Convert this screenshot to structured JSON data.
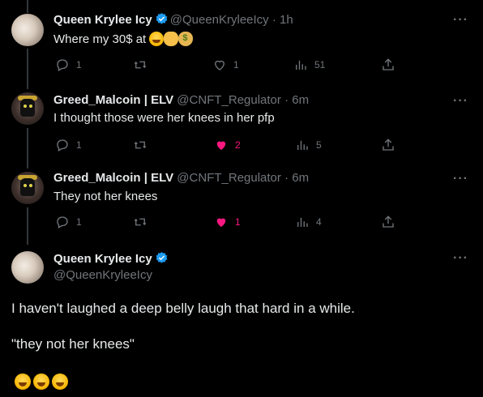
{
  "tweets": [
    {
      "name": "Queen Krylee Icy",
      "handle": "@QueenKryleeIcy · 1h",
      "text": "Where my 30$ at",
      "emojis": [
        "face-with-tears-of-joy",
        "call-me-hand",
        "money-bag"
      ],
      "replies": "1",
      "retweets": "",
      "likes": "1",
      "views": "51",
      "liked": false
    },
    {
      "name": "Greed_Malcoin | ELV",
      "handle": "@CNFT_Regulator · 6m",
      "text": "I thought those were her knees in her pfp",
      "replies": "1",
      "retweets": "",
      "likes": "2",
      "views": "5",
      "liked": true
    },
    {
      "name": "Greed_Malcoin | ELV",
      "handle": "@CNFT_Regulator · 6m",
      "text": "They not her knees",
      "replies": "1",
      "retweets": "",
      "likes": "1",
      "views": "4",
      "liked": true
    }
  ],
  "main_tweet": {
    "name": "Queen Krylee Icy",
    "handle": "@QueenKryleeIcy",
    "line1": "I haven't laughed a deep belly laugh that hard in a while.",
    "line2": "\"they not her knees\"",
    "emojis": [
      "face-with-tears-of-joy",
      "face-with-tears-of-joy",
      "face-with-tears-of-joy"
    ]
  },
  "colors": {
    "background": "#000000",
    "text": "#e7e9ea",
    "muted": "#71767b",
    "like": "#f91880",
    "verified": "#1d9bf0"
  }
}
